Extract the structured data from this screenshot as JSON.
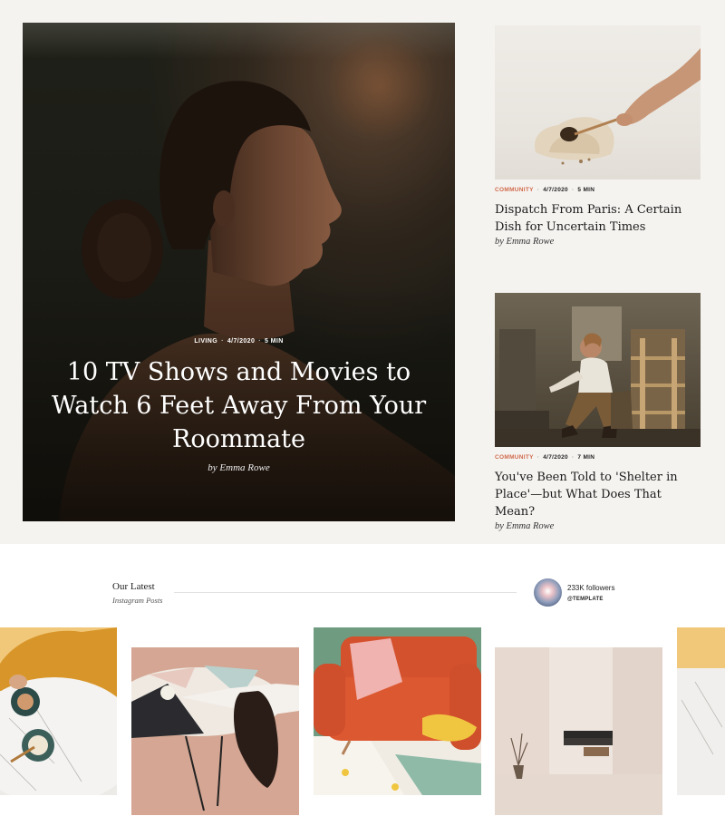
{
  "hero": {
    "category": "LIVING",
    "date": "4/7/2020",
    "read_time": "5 MIN",
    "title": "10 TV Shows and Movies to Watch 6 Feet Away From Your Roommate",
    "byline": "by Emma Rowe"
  },
  "cards": [
    {
      "category": "COMMUNITY",
      "date": "4/7/2020",
      "read_time": "5 MIN",
      "title": "Dispatch From Paris: A Certain Dish for Uncertain Times",
      "byline": "by Emma Rowe"
    },
    {
      "category": "COMMUNITY",
      "date": "4/7/2020",
      "read_time": "7 MIN",
      "title": "You've Been Told to 'Shelter in Place'—but What Does That Mean?",
      "byline": "by Emma Rowe"
    }
  ],
  "instagram": {
    "title": "Our Latest",
    "subtitle": "Instagram Posts",
    "followers": "233K followers",
    "handle": "@TEMPLATE"
  },
  "colors": {
    "accent": "#d06a4b",
    "page_background": "#f5f3f0"
  },
  "icons": {
    "separator": "·"
  }
}
